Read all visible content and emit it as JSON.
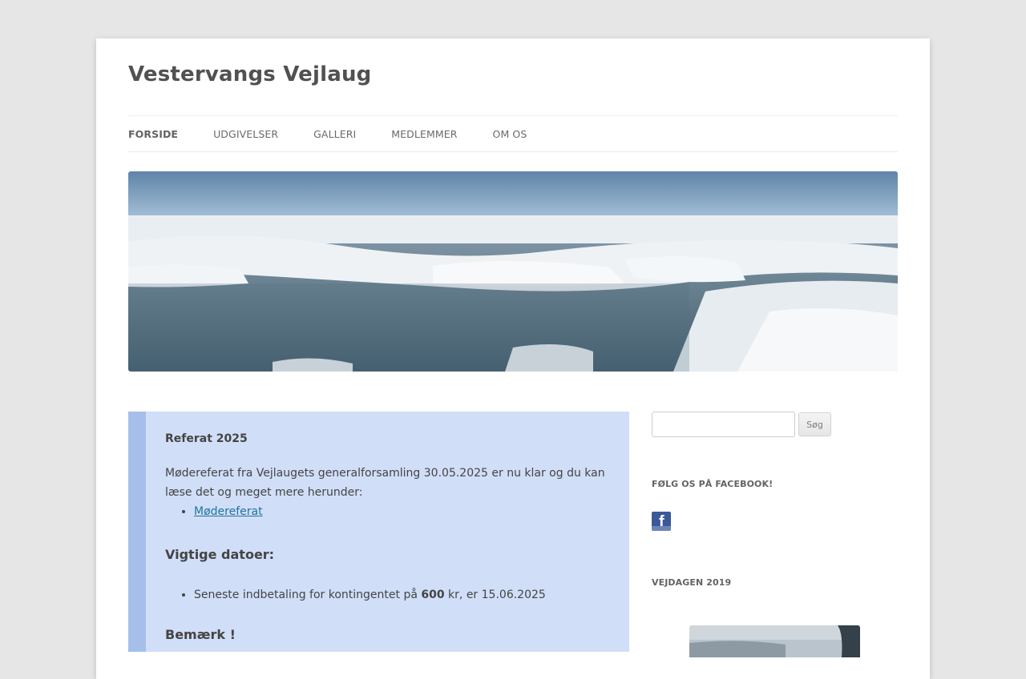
{
  "site": {
    "title": "Vestervangs Vejlaug"
  },
  "nav": {
    "items": [
      {
        "label": "FORSIDE",
        "current": true
      },
      {
        "label": "UDGIVELSER"
      },
      {
        "label": "GALLERI"
      },
      {
        "label": "MEDLEMMER"
      },
      {
        "label": "OM OS"
      }
    ]
  },
  "post": {
    "title": "Referat 2025",
    "intro": "Mødereferat fra Vejlaugets generalforsamling 30.05.2025 er nu klar og du kan læse det og meget mere herunder:",
    "link_label": "Mødereferat",
    "dates_heading": "Vigtige datoer:",
    "payment_prefix": "Seneste indbetaling for kontingentet på ",
    "payment_amount": "600",
    "payment_suffix": " kr, er 15.06.2025",
    "note_heading": "Bemærk !"
  },
  "sidebar": {
    "search_button": "Søg",
    "facebook_title": "FØLG OS PÅ FACEBOOK!",
    "facebook_icon": "facebook-icon",
    "vejdagen_title": "VEJDAGEN 2019"
  }
}
